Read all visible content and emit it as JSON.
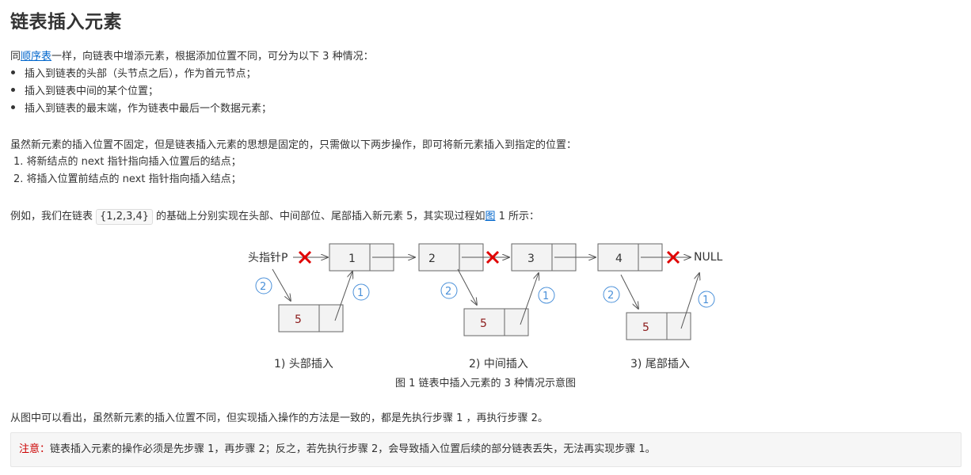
{
  "title": "链表插入元素",
  "intro": {
    "prefix": "同",
    "link": "顺序表",
    "suffix": "一样，向链表中增添元素，根据添加位置不同，可分为以下 3 种情况："
  },
  "cases": [
    "插入到链表的头部（头节点之后），作为首元节点；",
    "插入到链表中间的某个位置；",
    "插入到链表的最末端，作为链表中最后一个数据元素；"
  ],
  "idea": "虽然新元素的插入位置不固定，但是链表插入元素的思想是固定的，只需做以下两步操作，即可将新元素插入到指定的位置：",
  "steps": [
    "1. 将新结点的 next 指针指向插入位置后的结点；",
    "2. 将插入位置前结点的 next 指针指向插入结点；"
  ],
  "example": {
    "prefix": "例如，我们在链表",
    "code": "{1,2,3,4}",
    "middle": "的基础上分别实现在头部、中间部位、尾部插入新元素 5，其实现过程如",
    "link": "图",
    "suffix": " 1 所示："
  },
  "figure": {
    "head_pointer": "头指针P",
    "null_label": "NULL",
    "nodes": [
      "1",
      "2",
      "3",
      "4"
    ],
    "new_node": "5",
    "step_markers": [
      "①",
      "②"
    ],
    "sub_captions": [
      "1) 头部插入",
      "2) 中间插入",
      "3) 尾部插入"
    ],
    "caption": "图 1 链表中插入元素的 3 种情况示意图"
  },
  "conclusion": "从图中可以看出，虽然新元素的插入位置不同，但实现插入操作的方法是一致的，都是先执行步骤 1 ，再执行步骤 2。",
  "note": {
    "label": "注意：",
    "text": "链表插入元素的操作必须是先步骤 1，再步骤 2；反之，若先执行步骤 2，会导致插入位置后续的部分链表丢失，无法再实现步骤 1。"
  },
  "colors": {
    "link": "#0066cc",
    "note_label": "#cc0000",
    "cross": "#e00000",
    "marker": "#4a90d9",
    "new_value": "#8b1a1a"
  }
}
